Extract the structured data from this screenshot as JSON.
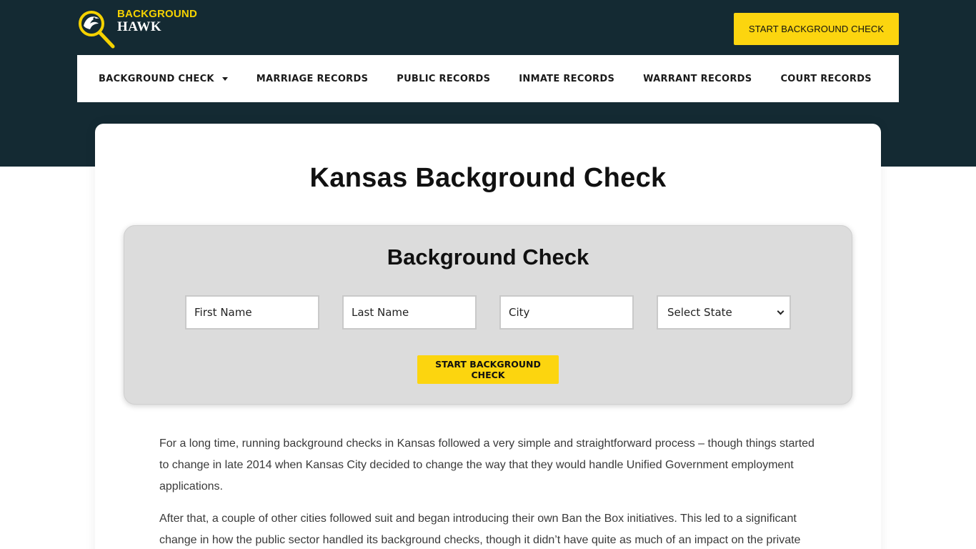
{
  "logo": {
    "line1": "BACKGROUND",
    "line2": "HAWK"
  },
  "header": {
    "cta_label": "START BACKGROUND CHECK"
  },
  "nav": {
    "items": [
      {
        "label": "BACKGROUND CHECK",
        "has_dropdown": true
      },
      {
        "label": "MARRIAGE RECORDS"
      },
      {
        "label": "PUBLIC RECORDS"
      },
      {
        "label": "INMATE RECORDS"
      },
      {
        "label": "WARRANT RECORDS"
      },
      {
        "label": "COURT RECORDS"
      }
    ]
  },
  "page": {
    "title": "Kansas Background Check"
  },
  "search_form": {
    "title": "Background Check",
    "first_name_placeholder": "First Name",
    "last_name_placeholder": "Last Name",
    "city_placeholder": "City",
    "state_selected": "Select State",
    "submit_label": "START BACKGROUND CHECK"
  },
  "content": {
    "paragraphs": [
      "For a long time, running background checks in Kansas followed a very simple and straightforward process – though things started to change in late 2014 when Kansas City decided to change the way that they would handle Unified Government employment applications.",
      "After that, a couple of other cities followed suit and began introducing their own Ban the Box initiatives. This led to a significant change in how the public sector handled its background checks, though it didn’t have quite as much of an impact on the private"
    ]
  },
  "colors": {
    "header_bg": "#142a33",
    "accent": "#fcd50f",
    "form_bg": "#dcdcdc"
  }
}
